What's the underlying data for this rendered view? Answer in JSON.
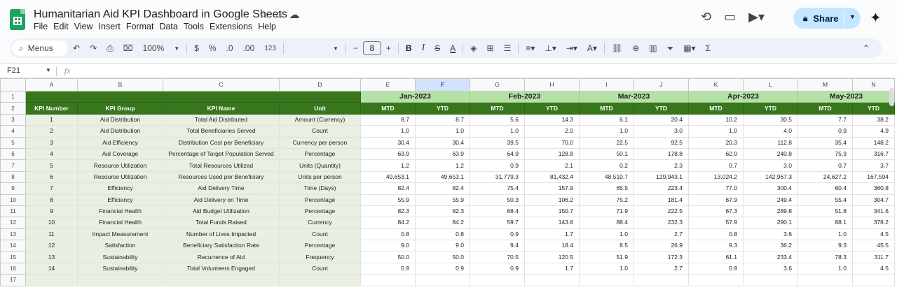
{
  "doc": {
    "title": "Humanitarian Aid KPI Dashboard in Google Sheets"
  },
  "menu": [
    "File",
    "Edit",
    "View",
    "Insert",
    "Format",
    "Data",
    "Tools",
    "Extensions",
    "Help"
  ],
  "share": {
    "label": "Share"
  },
  "toolbar": {
    "menus_label": "Menus",
    "zoom": "100%",
    "currency": "$",
    "percent": "%",
    "dec_down": ".0",
    "dec_up": ".00",
    "number_fmt": "123",
    "font_size": "8",
    "bold": "B",
    "italic": "I",
    "strike": "S",
    "text_color": "A",
    "func": "Σ"
  },
  "formula": {
    "cell_ref": "F21",
    "fx": "fx"
  },
  "columns": [
    "A",
    "B",
    "C",
    "D",
    "E",
    "F",
    "G",
    "H",
    "I",
    "J",
    "K",
    "L",
    "M",
    "N"
  ],
  "selected_column": "F",
  "months": [
    "Jan-2023",
    "Feb-2023",
    "Mar-2023",
    "Apr-2023",
    "May-2023"
  ],
  "headers": {
    "kpi_number": "KPI Number",
    "kpi_group": "KPI Group",
    "kpi_name": "KPI Name",
    "unit": "Unit",
    "mtd": "MTD",
    "ytd": "YTD"
  },
  "row_numbers": [
    "1",
    "2",
    "3",
    "4",
    "5",
    "6",
    "7",
    "8",
    "9",
    "10",
    "11",
    "12",
    "13",
    "14",
    "15",
    "16",
    "17"
  ],
  "rows": [
    {
      "num": "1",
      "group": "Aid Distribution",
      "name": "Total Aid Distributed",
      "unit": "Amount (Currency)",
      "vals": [
        "8.7",
        "8.7",
        "5.6",
        "14.3",
        "6.1",
        "20.4",
        "10.2",
        "30.5",
        "7.7",
        "38.2"
      ]
    },
    {
      "num": "2",
      "group": "Aid Distribution",
      "name": "Total Beneficiaries Served",
      "unit": "Count",
      "vals": [
        "1.0",
        "1.0",
        "1.0",
        "2.0",
        "1.0",
        "3.0",
        "1.0",
        "4.0",
        "0.9",
        "4.9"
      ]
    },
    {
      "num": "3",
      "group": "Aid Efficiency",
      "name": "Distribution Cost per Beneficiary",
      "unit": "Currency per person",
      "vals": [
        "30.4",
        "30.4",
        "39.5",
        "70.0",
        "22.5",
        "92.5",
        "20.3",
        "112.8",
        "35.4",
        "148.2"
      ]
    },
    {
      "num": "4",
      "group": "Aid Coverage",
      "name": "Percentage of Target Population Served",
      "unit": "Percentage",
      "vals": [
        "63.9",
        "63.9",
        "64.9",
        "128.8",
        "50.1",
        "178.8",
        "62.0",
        "240.8",
        "75.9",
        "316.7"
      ]
    },
    {
      "num": "5",
      "group": "Resource Utilization",
      "name": "Total Resources Utilized",
      "unit": "Units (Quantity)",
      "vals": [
        "1.2",
        "1.2",
        "0.9",
        "2.1",
        "0.2",
        "2.3",
        "0.7",
        "3.0",
        "0.7",
        "3.7"
      ]
    },
    {
      "num": "6",
      "group": "Resource Utilization",
      "name": "Resources Used per Beneficiary",
      "unit": "Units per person",
      "vals": [
        "49,653.1",
        "49,653.1",
        "31,779.3",
        "81,432.4",
        "48,510.7",
        "129,943.1",
        "13,024.2",
        "142,967.3",
        "24,627.2",
        "167,594"
      ]
    },
    {
      "num": "7",
      "group": "Efficiency",
      "name": "Aid Delivery Time",
      "unit": "Time (Days)",
      "vals": [
        "82.4",
        "82.4",
        "75.4",
        "157.9",
        "65.5",
        "223.4",
        "77.0",
        "300.4",
        "60.4",
        "360.8"
      ]
    },
    {
      "num": "8",
      "group": "Efficiency",
      "name": "Aid Delivery on Time",
      "unit": "Percentage",
      "vals": [
        "55.9",
        "55.9",
        "50.3",
        "106.2",
        "75.2",
        "181.4",
        "67.9",
        "249.4",
        "55.4",
        "304.7"
      ]
    },
    {
      "num": "9",
      "group": "Financial Health",
      "name": "Aid Budget Utilization",
      "unit": "Percentage",
      "vals": [
        "82.3",
        "82.3",
        "68.4",
        "150.7",
        "71.9",
        "222.5",
        "67.3",
        "289.8",
        "51.8",
        "341.6"
      ]
    },
    {
      "num": "10",
      "group": "Financial Health",
      "name": "Total Funds Raised",
      "unit": "Currency",
      "vals": [
        "84.2",
        "84.2",
        "59.7",
        "143.8",
        "88.4",
        "232.3",
        "57.9",
        "290.1",
        "88.1",
        "378.2"
      ]
    },
    {
      "num": "11",
      "group": "Impact Measurement",
      "name": "Number of Lives Impacted",
      "unit": "Count",
      "vals": [
        "0.8",
        "0.8",
        "0.9",
        "1.7",
        "1.0",
        "2.7",
        "0.8",
        "3.6",
        "1.0",
        "4.5"
      ]
    },
    {
      "num": "12",
      "group": "Satisfaction",
      "name": "Beneficiary Satisfaction Rate",
      "unit": "Percentage",
      "vals": [
        "9.0",
        "9.0",
        "9.4",
        "18.4",
        "8.5",
        "26.9",
        "9.3",
        "36.2",
        "9.3",
        "45.5"
      ]
    },
    {
      "num": "13",
      "group": "Sustainability",
      "name": "Recurrence of Aid",
      "unit": "Frequency",
      "vals": [
        "50.0",
        "50.0",
        "70.5",
        "120.5",
        "51.9",
        "172.3",
        "61.1",
        "233.4",
        "78.3",
        "311.7"
      ]
    },
    {
      "num": "14",
      "group": "Sustainability",
      "name": "Total Volunteers Engaged",
      "unit": "Count",
      "vals": [
        "0.9",
        "0.9",
        "0.9",
        "1.7",
        "1.0",
        "2.7",
        "0.9",
        "3.6",
        "1.0",
        "4.5"
      ]
    }
  ],
  "colors": {
    "header_dark": "#38761d",
    "month_header": "#b6e1a6",
    "dim_fill": "#e8f0e1",
    "share_bg": "#c2e7ff"
  }
}
